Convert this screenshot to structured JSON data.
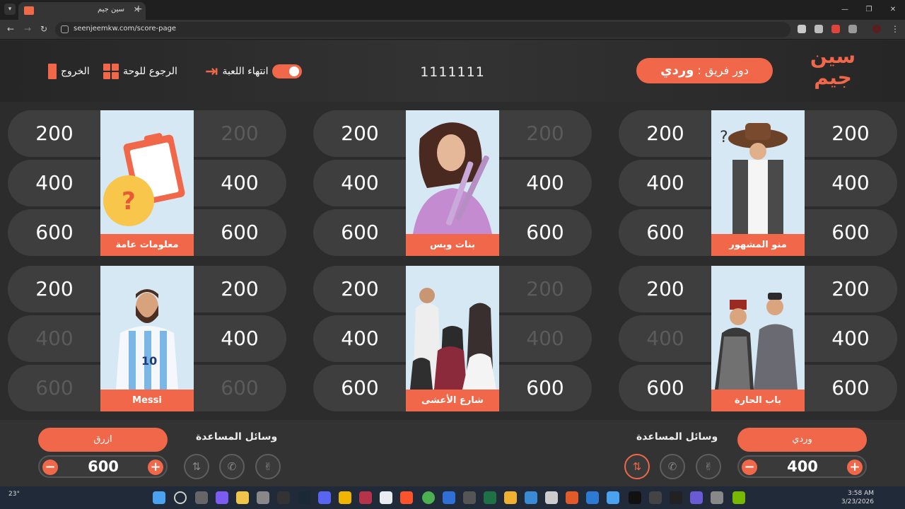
{
  "browser": {
    "tab_title": "سين جيم",
    "url": "seenjeemkw.com/score-page"
  },
  "header": {
    "turn_prefix": "دور فريق : ",
    "turn_team": "وردي",
    "game_code": "1111111",
    "end_game_label": "انتهاء اللعبة",
    "back_to_board_label": "الرجوع للوحة",
    "exit_label": "الخروج"
  },
  "categories": [
    {
      "name": "منو المشهور",
      "left": [
        "200",
        "400",
        "600"
      ],
      "left_used": [
        false,
        false,
        false
      ],
      "right": [
        "200",
        "400",
        "600"
      ],
      "right_used": [
        false,
        false,
        false
      ],
      "art": "cowboy-hat-man"
    },
    {
      "name": "بنات وبس",
      "left": [
        "200",
        "400",
        "600"
      ],
      "left_used": [
        false,
        false,
        false
      ],
      "right": [
        "200",
        "400",
        "600"
      ],
      "right_used": [
        true,
        false,
        false
      ],
      "art": "woman-hair-tools"
    },
    {
      "name": "معلومات عامة",
      "left": [
        "200",
        "400",
        "600"
      ],
      "left_used": [
        false,
        false,
        false
      ],
      "right": [
        "200",
        "400",
        "600"
      ],
      "right_used": [
        true,
        false,
        false
      ],
      "art": "clipboard-question"
    },
    {
      "name": "باب الحارة",
      "left": [
        "200",
        "400",
        "600"
      ],
      "left_used": [
        false,
        true,
        false
      ],
      "right": [
        "200",
        "400",
        "600"
      ],
      "right_used": [
        false,
        false,
        false
      ],
      "art": "two-men-traditional"
    },
    {
      "name": "شارع الأعشى",
      "left": [
        "200",
        "400",
        "600"
      ],
      "left_used": [
        false,
        false,
        false
      ],
      "right": [
        "200",
        "400",
        "600"
      ],
      "right_used": [
        true,
        true,
        false
      ],
      "art": "family-group"
    },
    {
      "name": "Messi",
      "left": [
        "200",
        "400",
        "600"
      ],
      "left_used": [
        false,
        true,
        true
      ],
      "right": [
        "200",
        "400",
        "600"
      ],
      "right_used": [
        false,
        false,
        true
      ],
      "art": "football-player"
    }
  ],
  "teams": {
    "right": {
      "name": "وردي",
      "score": "400",
      "aids_title": "وسائل المساعدة"
    },
    "left": {
      "name": "ازرق",
      "score": "600",
      "aids_title": "وسائل المساعدة"
    }
  },
  "taskbar": {
    "weather": "23°",
    "time": "3:58 AM",
    "date": "3/23/2026"
  },
  "colors": {
    "accent": "#f0674a",
    "pill": "#3e3e3e",
    "bg": "#2b2b2b"
  }
}
